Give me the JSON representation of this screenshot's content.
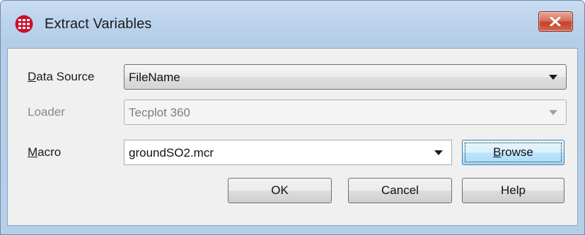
{
  "window": {
    "title": "Extract Variables",
    "close_label": "✕"
  },
  "form": {
    "data_source": {
      "label_prefix": "D",
      "label_rest": "ata Source",
      "value": "FileName"
    },
    "loader": {
      "label": "Loader",
      "value": "Tecplot 360"
    },
    "macro": {
      "label_prefix": "M",
      "label_rest": "acro",
      "value": "groundSO2.mcr"
    }
  },
  "buttons": {
    "browse_prefix": "B",
    "browse_rest": "rowse",
    "ok": "OK",
    "cancel": "Cancel",
    "help": "Help"
  },
  "colors": {
    "close_button": "#c4412c",
    "app_icon": "#c8102e"
  }
}
